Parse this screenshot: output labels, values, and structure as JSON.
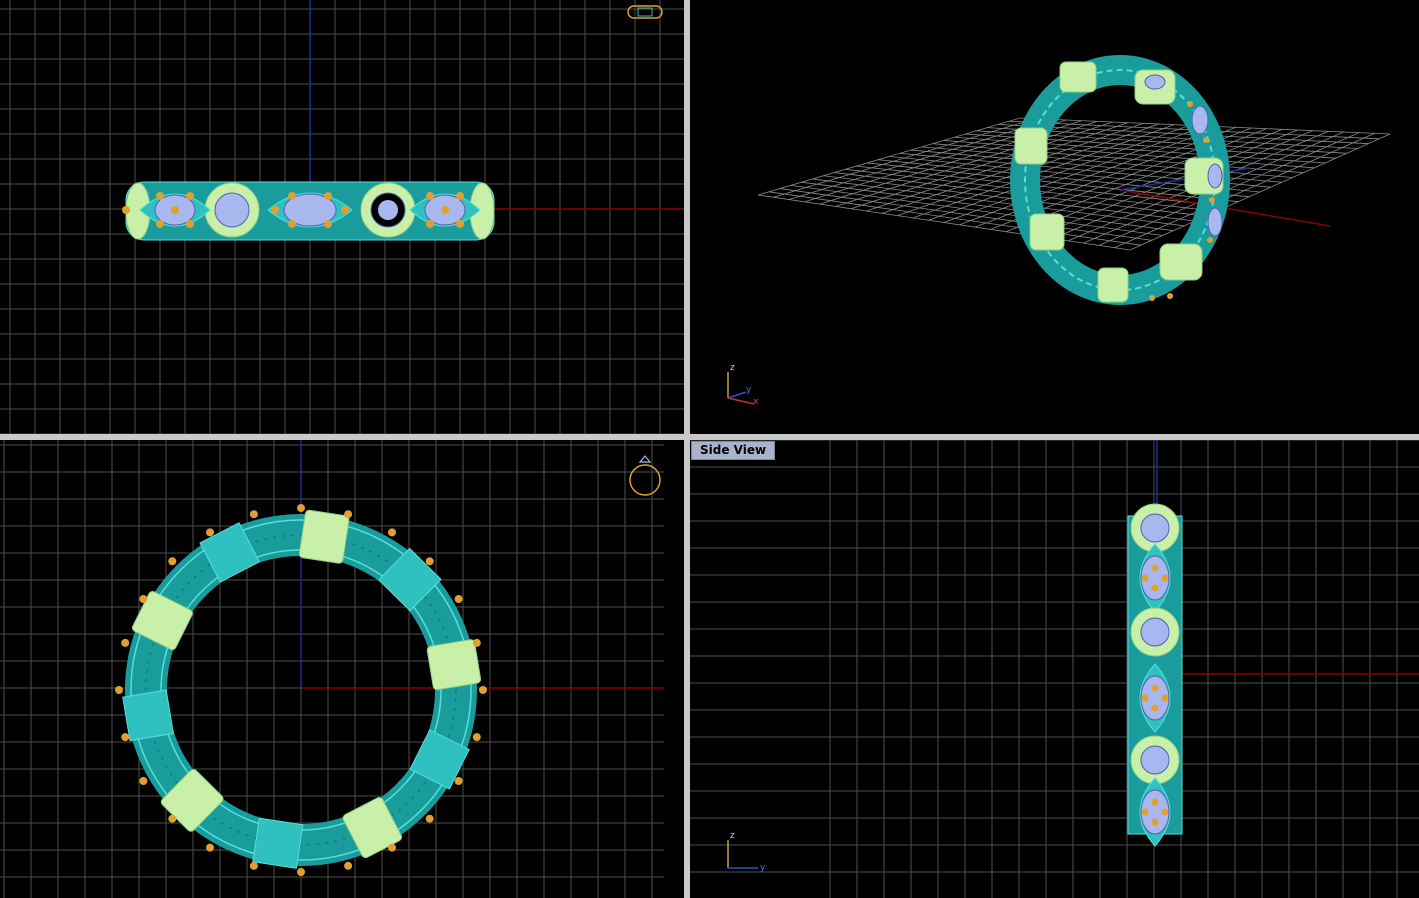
{
  "viewports": {
    "front": {
      "label": ""
    },
    "perspective": {
      "label": "",
      "axis_labels": {
        "z": "z",
        "y": "y",
        "x": "x"
      }
    },
    "top": {
      "label": ""
    },
    "side": {
      "label": "Side View",
      "axis_labels": {
        "z": "z",
        "y": "y"
      }
    }
  },
  "colors": {
    "background": "#000000",
    "grid": "#5a5a5a",
    "grid_major": "#7a7a7a",
    "axis_x": "#8b0000",
    "axis_y": "#1a2fa0",
    "metal": "#2fc0c0",
    "metal_light": "#56e0d8",
    "setting": "#c8f0a8",
    "stone": "#a8b8ee",
    "prong": "#e0a030",
    "frame_gap": "#c8c8c8",
    "label_bg": "#a9b4cc"
  },
  "model": {
    "name_icon": "ring-icon",
    "marquise_count": 5,
    "round_count": 5
  }
}
